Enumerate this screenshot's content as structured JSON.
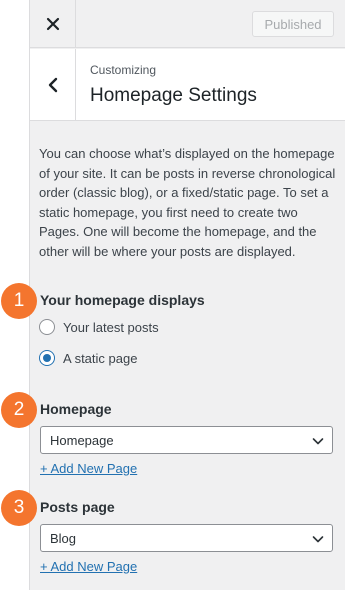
{
  "topbar": {
    "close_icon": "close-icon",
    "publish_label": "Published"
  },
  "section": {
    "back_icon": "chevron-left-icon",
    "meta": "Customizing",
    "title": "Homepage Settings"
  },
  "description": "You can choose what’s displayed on the homepage of your site. It can be posts in reverse chronological order (classic blog), or a fixed/static page. To set a static homepage, you first need to create two Pages. One will become the homepage, and the other will be where your posts are displayed.",
  "homepage_displays": {
    "title": "Your homepage displays",
    "options": [
      {
        "label": "Your latest posts",
        "checked": false
      },
      {
        "label": "A static page",
        "checked": true
      }
    ]
  },
  "homepage": {
    "title": "Homepage",
    "selected": "Homepage",
    "add_link": "+ Add New Page"
  },
  "posts_page": {
    "title": "Posts page",
    "selected": "Blog",
    "add_link": "+ Add New Page"
  },
  "callouts": [
    "1",
    "2",
    "3"
  ],
  "colors": {
    "accent": "#2271b1",
    "callout": "#f4752e",
    "panel_bg": "#f0f0f1"
  }
}
